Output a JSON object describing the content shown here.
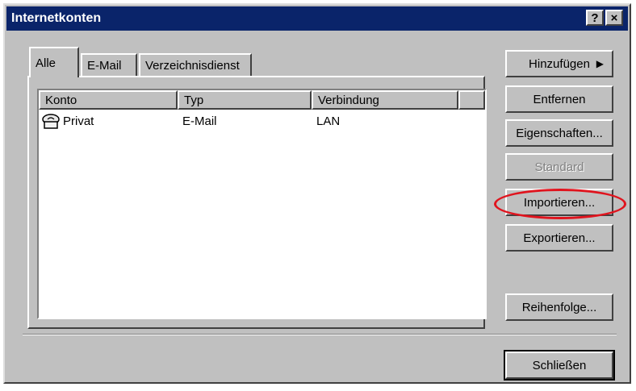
{
  "window": {
    "title": "Internetkonten",
    "help_btn": "?",
    "close_btn": "×"
  },
  "tabs": [
    "Alle",
    "E-Mail",
    "Verzeichnisdienst"
  ],
  "list": {
    "headers": [
      "Konto",
      "Typ",
      "Verbindung"
    ],
    "rows": [
      {
        "konto": "Privat",
        "typ": "E-Mail",
        "verbindung": "LAN"
      }
    ]
  },
  "buttons": {
    "add": "Hinzufügen",
    "add_arrow": "▶",
    "remove": "Entfernen",
    "properties": "Eigenschaften...",
    "default": "Standard",
    "import": "Importieren...",
    "export": "Exportieren...",
    "order": "Reihenfolge...",
    "close": "Schließen"
  },
  "colors": {
    "titlebar": "#0a246a",
    "highlight_ellipse": "#e0141e",
    "face": "#c0c0c0"
  }
}
